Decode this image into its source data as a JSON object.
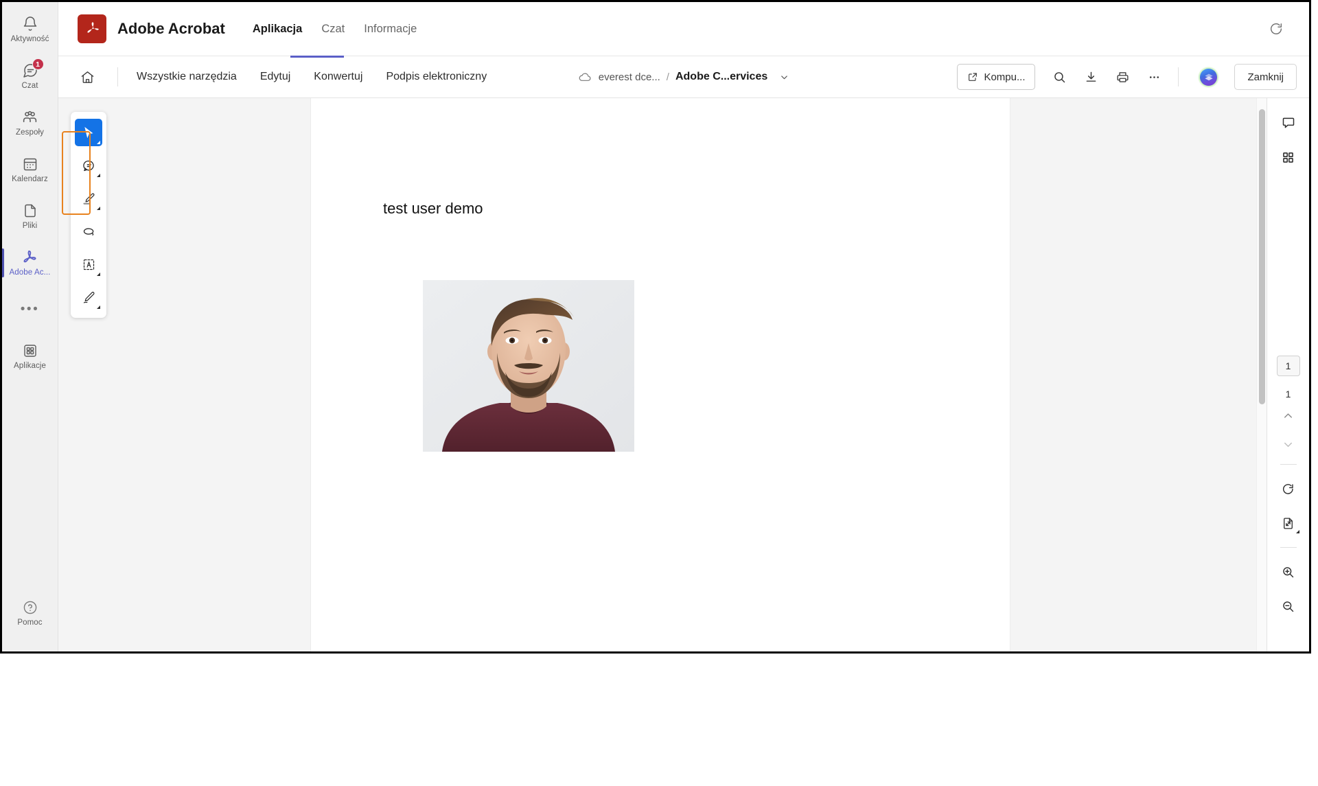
{
  "teams_rail": {
    "items": [
      {
        "label": "Aktywność",
        "icon": "bell-icon",
        "badge": null,
        "active": false
      },
      {
        "label": "Czat",
        "icon": "chat-icon",
        "badge": "1",
        "active": false
      },
      {
        "label": "Zespoły",
        "icon": "teams-people-icon",
        "badge": null,
        "active": false
      },
      {
        "label": "Kalendarz",
        "icon": "calendar-icon",
        "badge": null,
        "active": false
      },
      {
        "label": "Pliki",
        "icon": "file-icon",
        "badge": null,
        "active": false
      },
      {
        "label": "Adobe Ac...",
        "icon": "adobe-acrobat-icon",
        "badge": null,
        "active": true
      }
    ],
    "more_label": "•••",
    "apps": {
      "label": "Aplikacje",
      "icon": "apps-grid-icon"
    },
    "help": {
      "label": "Pomoc",
      "icon": "question-circle-icon"
    },
    "badge_color": "#c4314b",
    "active_color": "#5b5fc7"
  },
  "app_header": {
    "logo_icon": "adobe-acrobat-logo",
    "logo_color": "#b3261b",
    "title": "Adobe Acrobat",
    "tabs": [
      {
        "label": "Aplikacja",
        "active": true
      },
      {
        "label": "Czat",
        "active": false
      },
      {
        "label": "Informacje",
        "active": false
      }
    ],
    "refresh_icon": "refresh-icon"
  },
  "toolbar": {
    "home_icon": "home-icon",
    "menus": [
      {
        "label": "Wszystkie narzędzia"
      },
      {
        "label": "Edytuj"
      },
      {
        "label": "Konwertuj"
      },
      {
        "label": "Podpis elektroniczny"
      }
    ],
    "breadcrumb": {
      "cloud_icon": "cloud-icon",
      "folder": "everest dce...",
      "separator": "/",
      "file": "Adobe C...ervices",
      "chevron_icon": "chevron-down-icon"
    },
    "open_desktop": {
      "label": "Kompu...",
      "icon": "external-link-icon"
    },
    "icons": [
      {
        "name": "search-icon"
      },
      {
        "name": "download-icon"
      },
      {
        "name": "print-icon"
      },
      {
        "name": "more-horizontal-icon"
      }
    ],
    "avatar": {
      "name": "user-avatar",
      "status_color": "#92d050"
    },
    "close_label": "Zamknij",
    "active_tab_underline_color": "#5b5fc7"
  },
  "tool_palette": {
    "tools": [
      {
        "name": "select-cursor-tool",
        "icon": "cursor-icon",
        "active": true,
        "has_caret": true
      },
      {
        "name": "comment-tool",
        "icon": "comment-bubble-icon",
        "active": false,
        "has_caret": true
      },
      {
        "name": "highlight-tool",
        "icon": "highlighter-icon",
        "active": false,
        "has_caret": true
      },
      {
        "name": "lasso-tool",
        "icon": "lasso-loop-icon",
        "active": false,
        "has_caret": false
      },
      {
        "name": "text-select-tool",
        "icon": "text-box-a-icon",
        "active": false,
        "has_caret": true
      },
      {
        "name": "draw-tool",
        "icon": "pen-draw-icon",
        "active": false,
        "has_caret": true
      }
    ],
    "highlight_color": "#e8821e"
  },
  "document": {
    "heading": "test user demo",
    "photo": {
      "name": "portrait-photo",
      "alt": "portrait of a bearded man in a maroon shirt on light gray background"
    }
  },
  "right_rail": {
    "top_buttons": [
      {
        "name": "comments-panel-button",
        "icon": "comment-square-icon"
      },
      {
        "name": "page-thumbnails-button",
        "icon": "grid-squares-icon"
      }
    ],
    "page_nav": {
      "current_page": "1",
      "total_pages": "1",
      "prev_icon": "chevron-up-icon",
      "next_icon": "chevron-down-icon"
    },
    "tools": [
      {
        "name": "rotate-button",
        "icon": "rotate-cw-icon",
        "has_caret": false
      },
      {
        "name": "fit-page-button",
        "icon": "fit-page-icon",
        "has_caret": true
      },
      {
        "name": "zoom-in-button",
        "icon": "zoom-in-icon",
        "has_caret": false
      },
      {
        "name": "zoom-out-button",
        "icon": "zoom-out-icon",
        "has_caret": false
      }
    ]
  }
}
